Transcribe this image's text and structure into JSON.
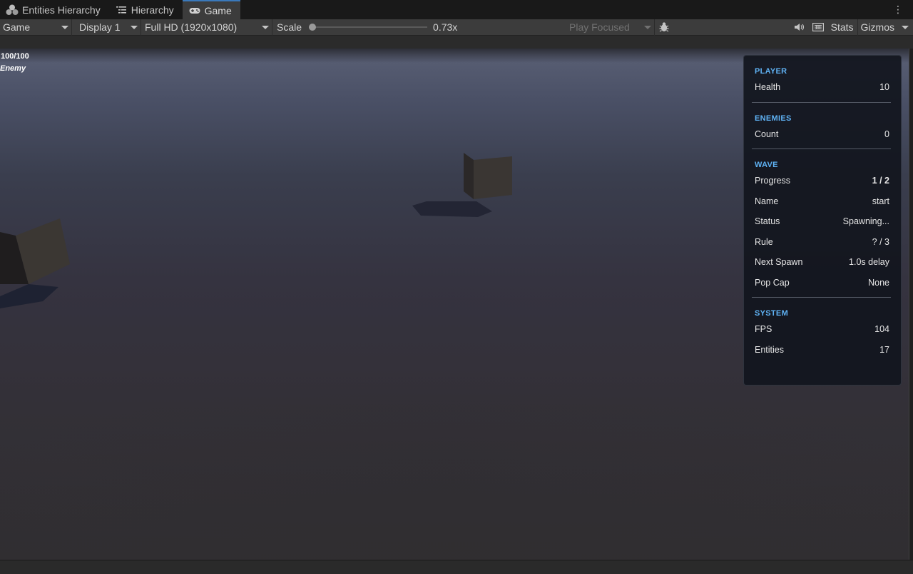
{
  "tabs": [
    {
      "label": "Entities Hierarchy",
      "icon": "entities-icon",
      "active": false
    },
    {
      "label": "Hierarchy",
      "icon": "hierarchy-list-icon",
      "active": false
    },
    {
      "label": "Game",
      "icon": "gamepad-icon",
      "active": true
    }
  ],
  "toolbar": {
    "view_select": "Game",
    "display_select": "Display 1",
    "resolution_select": "Full HD (1920x1080)",
    "scale_label": "Scale",
    "scale_value": "0.73x",
    "play_mode_select": "Play Focused",
    "stats_label": "Stats",
    "gizmos_label": "Gizmos"
  },
  "hud": {
    "health_text": "100/100",
    "target_name": "Enemy"
  },
  "panel": {
    "player": {
      "title": "PLAYER",
      "health_label": "Health",
      "health_value": "10"
    },
    "enemies": {
      "title": "ENEMIES",
      "count_label": "Count",
      "count_value": "0"
    },
    "wave": {
      "title": "WAVE",
      "progress_label": "Progress",
      "progress_value": "1 / 2",
      "name_label": "Name",
      "name_value": "start",
      "status_label": "Status",
      "status_value": "Spawning...",
      "rule_label": "Rule",
      "rule_value": "? / 3",
      "next_spawn_label": "Next Spawn",
      "next_spawn_value": "1.0s delay",
      "pop_cap_label": "Pop Cap",
      "pop_cap_value": "None"
    },
    "system": {
      "title": "SYSTEM",
      "fps_label": "FPS",
      "fps_value": "104",
      "entities_label": "Entities",
      "entities_value": "17"
    }
  },
  "colors": {
    "accent": "#5fb2f4",
    "active_tab_border": "#3a79bb",
    "panel_bg": "#12161e"
  }
}
